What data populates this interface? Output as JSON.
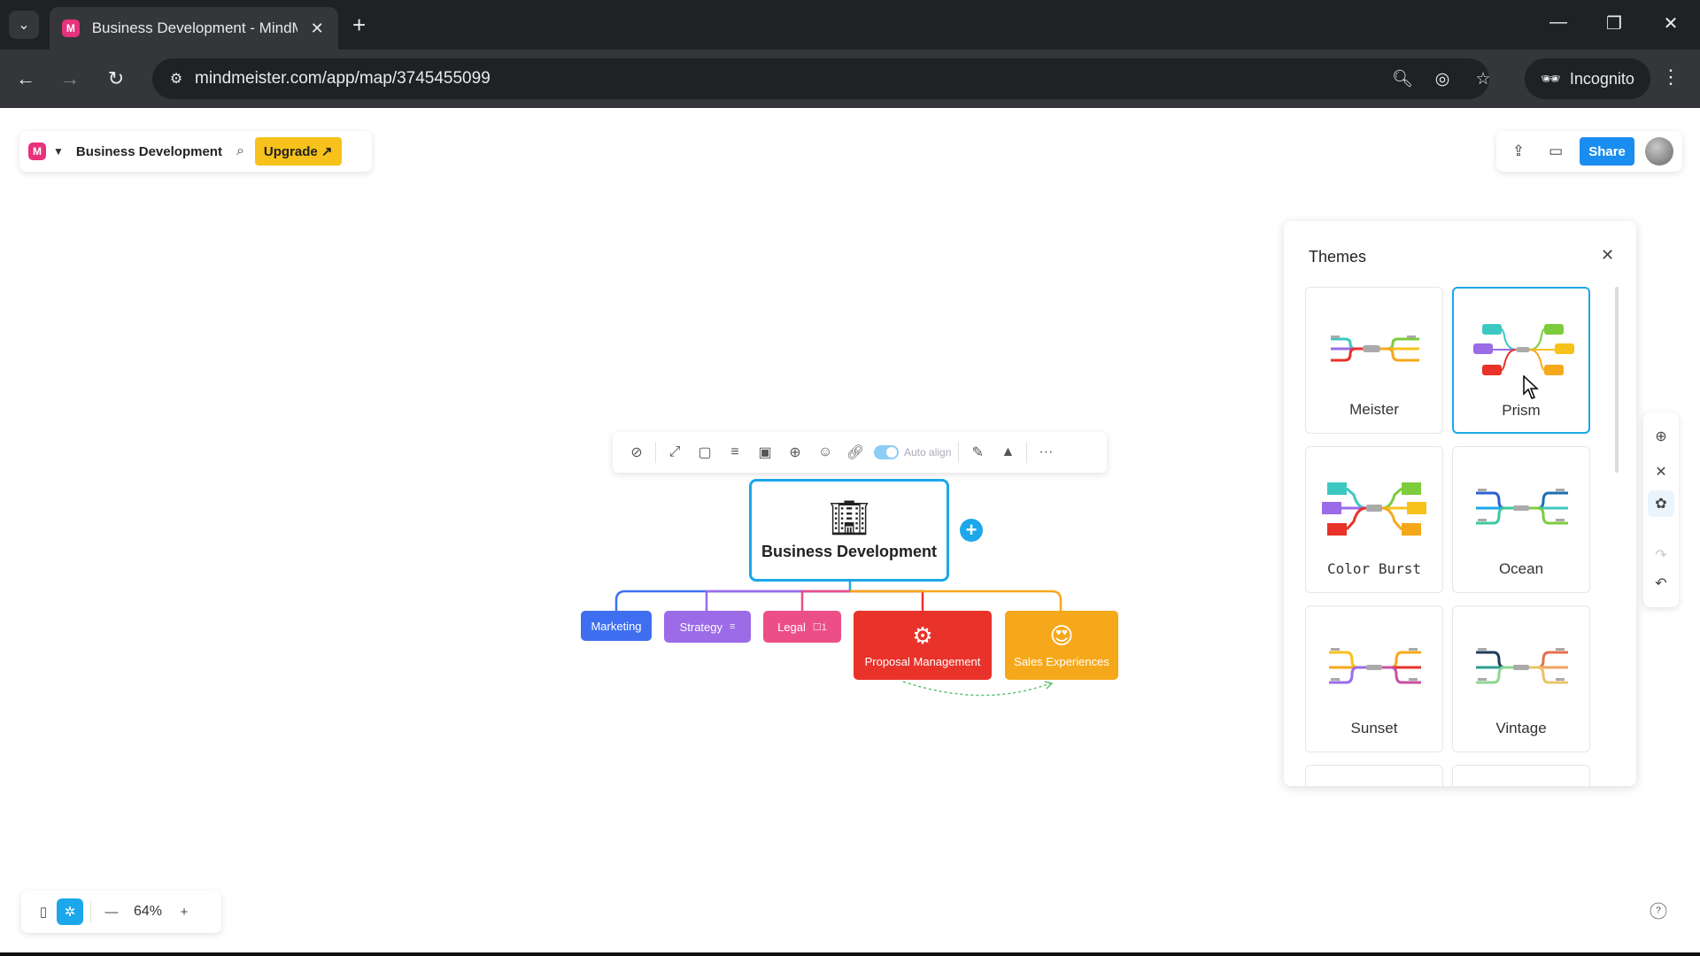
{
  "browser": {
    "tab_title": "Business Development - MindM",
    "favicon_letter": "M",
    "url": "mindmeister.com/app/map/3745455099",
    "incognito_label": "Incognito",
    "icons": [
      "tab-search-icon",
      "close-icon",
      "plus-icon",
      "minimize-icon",
      "restore-icon",
      "back-icon",
      "forward-icon",
      "reload-icon",
      "site-info-icon",
      "zoom-icon",
      "eye-off-icon",
      "star-icon",
      "incognito-icon",
      "kebab-icon"
    ]
  },
  "app": {
    "map_title": "Business Development",
    "upgrade_label": "Upgrade ↗",
    "share_label": "Share",
    "brand_color": "#e8327c",
    "accent_color": "#1ba7ea",
    "upgrade_color": "#f6c21b",
    "share_color": "#1a8df0"
  },
  "node_toolbar": {
    "auto_align_label": "Auto align",
    "auto_align_on": true
  },
  "mindmap": {
    "root": {
      "label": "Business Development",
      "icon": "office-building-icon"
    },
    "children": [
      {
        "label": "Marketing",
        "color": "#3f6ff0"
      },
      {
        "label": "Strategy",
        "color": "#9b6be8",
        "badge": "≡"
      },
      {
        "label": "Legal",
        "color": "#ec4f87",
        "badge": "☐1"
      },
      {
        "label": "Proposal Management",
        "color": "#e8322a",
        "icon": "bulb-icon"
      },
      {
        "label": "Sales Experiences",
        "color": "#f6a81b",
        "icon": "heart-eyes-icon"
      }
    ]
  },
  "themes": {
    "title": "Themes",
    "selected": "Prism",
    "items": [
      {
        "name": "Meister"
      },
      {
        "name": "Prism"
      },
      {
        "name": "Color Burst"
      },
      {
        "name": "Ocean"
      },
      {
        "name": "Sunset"
      },
      {
        "name": "Vintage"
      }
    ]
  },
  "bottom": {
    "zoom_level": "64%"
  }
}
